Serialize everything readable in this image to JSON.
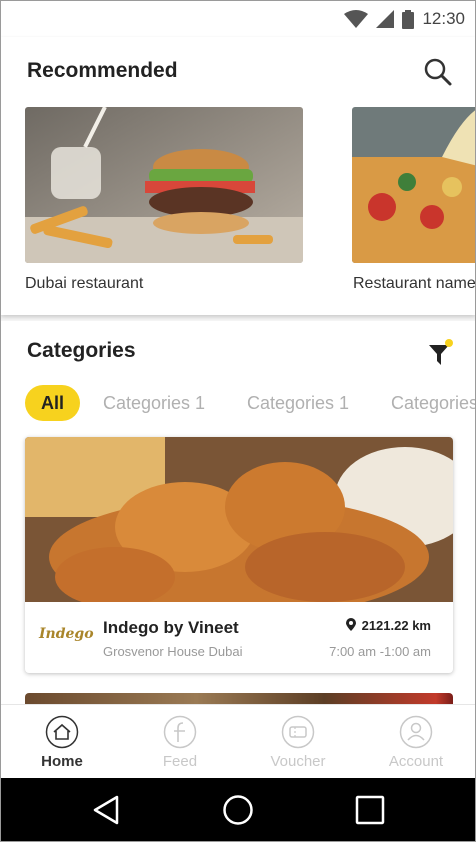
{
  "status_bar": {
    "time": "12:30"
  },
  "recommended": {
    "title": "Recommended",
    "items": [
      {
        "label": "Dubai restaurant",
        "image": "burger-photo"
      },
      {
        "label": "Restaurant name",
        "image": "pizza-photo"
      }
    ]
  },
  "categories": {
    "title": "Categories",
    "chips": [
      "All",
      "Categories 1",
      "Categories 1",
      "Categories"
    ],
    "active_chip": "All"
  },
  "restaurant": {
    "logo_text": "Indego",
    "name": "Indego by Vineet",
    "address": "Grosvenor House Dubai",
    "distance": "2121.22 km",
    "hours": "7:00 am -1:00 am",
    "image": "fried-chicken-photo"
  },
  "bottom_nav": [
    {
      "label": "Home",
      "icon": "home-icon",
      "active": true
    },
    {
      "label": "Feed",
      "icon": "feed-icon",
      "active": false
    },
    {
      "label": "Voucher",
      "icon": "voucher-icon",
      "active": false
    },
    {
      "label": "Account",
      "icon": "account-icon",
      "active": false
    }
  ],
  "colors": {
    "accent": "#f7d21e",
    "inactive": "#c8c8c8",
    "system_nav": "#000000"
  }
}
